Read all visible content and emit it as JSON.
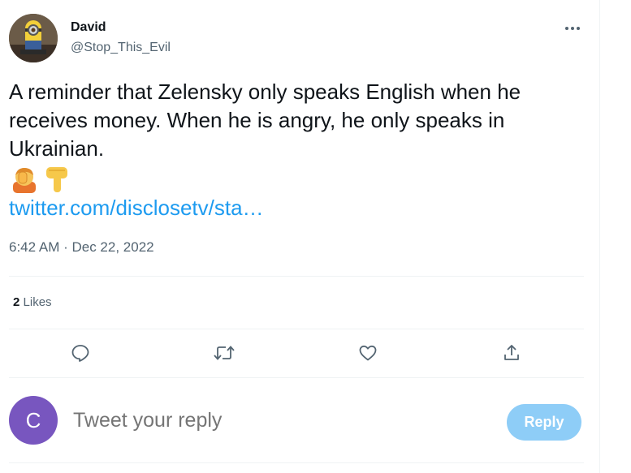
{
  "author": {
    "display_name": "David",
    "handle": "@Stop_This_Evil",
    "avatar_icon": "minion-avatar-icon"
  },
  "tweet": {
    "text": "A reminder that Zelensky only speaks English when he receives money. When he is angry, he only speaks in Ukrainian.",
    "emojis": [
      "facepalm-emoji",
      "pointing-down-emoji"
    ],
    "link_text": "twitter.com/disclosetv/sta…",
    "timestamp": "6:42 AM · Dec 22, 2022"
  },
  "stats": {
    "likes_count": "2",
    "likes_label": "Likes"
  },
  "actions": [
    "reply-icon",
    "retweet-icon",
    "like-icon",
    "share-icon"
  ],
  "compose": {
    "avatar_letter": "C",
    "placeholder": "Tweet your reply",
    "reply_label": "Reply"
  },
  "colors": {
    "link": "#1d9bf0",
    "reply_button": "#8ecdf7",
    "reply_avatar": "#7856bf",
    "secondary_text": "#536471"
  }
}
